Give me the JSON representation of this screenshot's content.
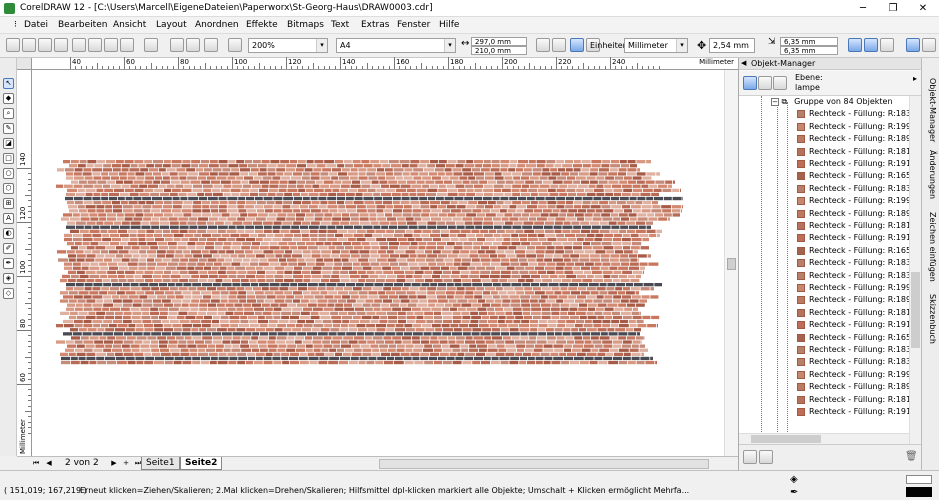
{
  "window": {
    "title": "CorelDRAW 12 - [C:\\Users\\Marcell\\EigeneDateien\\Paperworx\\St-Georg-Haus\\DRAW0003.cdr]",
    "minimize": "─",
    "restore": "❐",
    "close": "✕"
  },
  "menu": [
    "Datei",
    "Bearbeiten",
    "Ansicht",
    "Layout",
    "Anordnen",
    "Effekte",
    "Bitmaps",
    "Text",
    "Extras",
    "Fenster",
    "Hilfe"
  ],
  "toolbar": {
    "zoom": "200%",
    "paper": "A4",
    "width": "297,0 mm",
    "height": "210,0 mm",
    "units_label": "Einheiten:",
    "units": "Millimeter",
    "nudge": "2,54 mm",
    "dup_x": "6,35 mm",
    "dup_y": "6,35 mm"
  },
  "ruler": {
    "unit": "Millimeter",
    "h_labels": [
      "40",
      "60",
      "80",
      "100",
      "120",
      "140",
      "160",
      "180",
      "200",
      "220",
      "240"
    ],
    "v_labels": [
      "140",
      "120",
      "100",
      "80",
      "60"
    ],
    "v_unit": "Millimeter"
  },
  "pages": {
    "first": "⏮",
    "prev": "◀",
    "count": "2 von 2",
    "next": "▶",
    "last": "⏭",
    "add": "+",
    "tabs": [
      "Seite1",
      "Seite2"
    ]
  },
  "status": {
    "coords": "( 151,019; 167,219 )",
    "message": "Erneut klicken=Ziehen/Skalieren; 2.Mal klicken=Drehen/Skalieren; Hilfsmittel dpl-klicken markiert alle Objekte; Umschalt + Klicken ermöglicht Mehrfa..."
  },
  "panel": {
    "title": "Objekt-Manager",
    "layer_label": "Ebene:",
    "layer_name": "lampe",
    "group": "Gruppe von 84 Objekten",
    "items": [
      {
        "label": "Rechteck - Füllung: R:183 G",
        "color": "#b7806a"
      },
      {
        "label": "Rechteck - Füllung: R:199 G",
        "color": "#c7866e"
      },
      {
        "label": "Rechteck - Füllung: R:189 G",
        "color": "#bd7a62"
      },
      {
        "label": "Rechteck - Füllung: R:181 G",
        "color": "#b5725c"
      },
      {
        "label": "Rechteck - Füllung: R:191 G",
        "color": "#bf6c58"
      },
      {
        "label": "Rechteck - Füllung: R:165 G",
        "color": "#a5624e"
      },
      {
        "label": "Rechteck - Füllung: R:183 G",
        "color": "#b7806a"
      },
      {
        "label": "Rechteck - Füllung: R:199 G",
        "color": "#c7866e"
      },
      {
        "label": "Rechteck - Füllung: R:189 G",
        "color": "#bd7a62"
      },
      {
        "label": "Rechteck - Füllung: R:181 G",
        "color": "#b5725c"
      },
      {
        "label": "Rechteck - Füllung: R:191 G",
        "color": "#bf6c58"
      },
      {
        "label": "Rechteck - Füllung: R:165 G",
        "color": "#a5624e"
      },
      {
        "label": "Rechteck - Füllung: R:183 G",
        "color": "#b7806a"
      },
      {
        "label": "Rechteck - Füllung: R:183 G",
        "color": "#b7806a"
      },
      {
        "label": "Rechteck - Füllung: R:199 G",
        "color": "#c7866e"
      },
      {
        "label": "Rechteck - Füllung: R:189 G",
        "color": "#bd7a62"
      },
      {
        "label": "Rechteck - Füllung: R:181 G",
        "color": "#b5725c"
      },
      {
        "label": "Rechteck - Füllung: R:191 G",
        "color": "#bf6c58"
      },
      {
        "label": "Rechteck - Füllung: R:165 G",
        "color": "#a5624e"
      },
      {
        "label": "Rechteck - Füllung: R:183 G",
        "color": "#b7806a"
      },
      {
        "label": "Rechteck - Füllung: R:183 G",
        "color": "#b7806a"
      },
      {
        "label": "Rechteck - Füllung: R:199 G",
        "color": "#c7866e"
      },
      {
        "label": "Rechteck - Füllung: R:189 G",
        "color": "#bd7a62"
      },
      {
        "label": "Rechteck - Füllung: R:181 G",
        "color": "#b5725c"
      },
      {
        "label": "Rechteck - Füllung: R:191 G",
        "color": "#bf6c58"
      }
    ]
  },
  "sidetabs": [
    "Objekt-Manager",
    "Änderungen",
    "Zeichen einfügen",
    "Skizzenbuch"
  ],
  "colors": {
    "brick_light": "#d99a84",
    "brick_mid": "#c9785f",
    "brick_dark": "#a85c48",
    "mortar_dark": "#4a4a52",
    "accent_blue": "#7aa8e6"
  }
}
